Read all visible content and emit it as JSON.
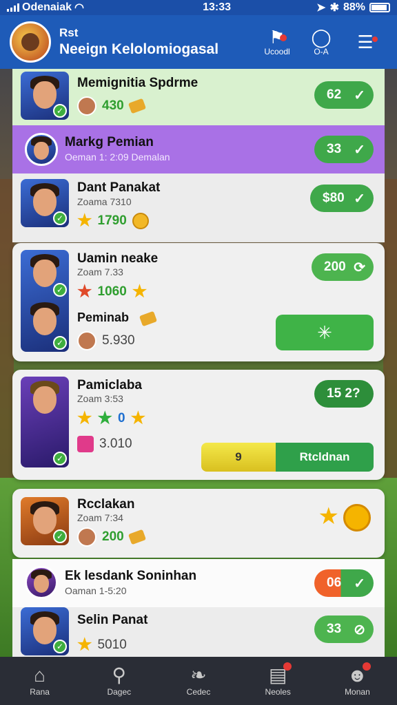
{
  "status_bar": {
    "carrier": "Odenaiak",
    "time": "13:33",
    "battery": "88%"
  },
  "header": {
    "title_small": "Rst",
    "title": "Neeign Kelolomiogasal",
    "buttons": [
      {
        "label": "Ucoodl",
        "icon": "bell-icon"
      },
      {
        "label": "O-A",
        "icon": "circle-icon"
      },
      {
        "label": "",
        "icon": "edit-list-icon"
      }
    ]
  },
  "rows": [
    {
      "name": "Memignitia Spdrme",
      "sub": "",
      "value": "430",
      "pill": "62"
    },
    {
      "name": "Markg Pemian",
      "sub": "Oeman 1: 2:09 Demalan",
      "pill": "33"
    },
    {
      "name": "Dant Panakat",
      "sub": "Zoama 7310",
      "value": "1790",
      "pill": "$80"
    },
    {
      "name": "Uamin neake",
      "sub": "Zoam 7.33",
      "value": "1060",
      "pill": "200",
      "second_name": "Peminab",
      "second_value": "5.930"
    },
    {
      "name": "Pamiclaba",
      "sub": "Zoam 3:53",
      "value": "0",
      "pill": "15  2?",
      "second_value": "3.010",
      "bar_left": "9",
      "bar_right": "Rtcldnan"
    },
    {
      "name": "Rcclakan",
      "sub": "Zoam 7:34",
      "value": "200"
    },
    {
      "name": "Ek lesdank Soninhan",
      "sub": "Oaman 1-5:20",
      "pill": "06"
    },
    {
      "name": "Selin Panat",
      "sub": "",
      "value": "5010",
      "pill": "33"
    }
  ],
  "nav": [
    {
      "label": "Rana",
      "icon": "home-icon"
    },
    {
      "label": "Dagec",
      "icon": "search-icon"
    },
    {
      "label": "Cedec",
      "icon": "leaf-icon"
    },
    {
      "label": "Neoles",
      "icon": "news-icon"
    },
    {
      "label": "Monan",
      "icon": "profile-icon"
    }
  ],
  "colors": {
    "header": "#1e5bb8",
    "accent_green": "#3fa84a",
    "purple": "#a971e6",
    "badge": "#e53935"
  }
}
